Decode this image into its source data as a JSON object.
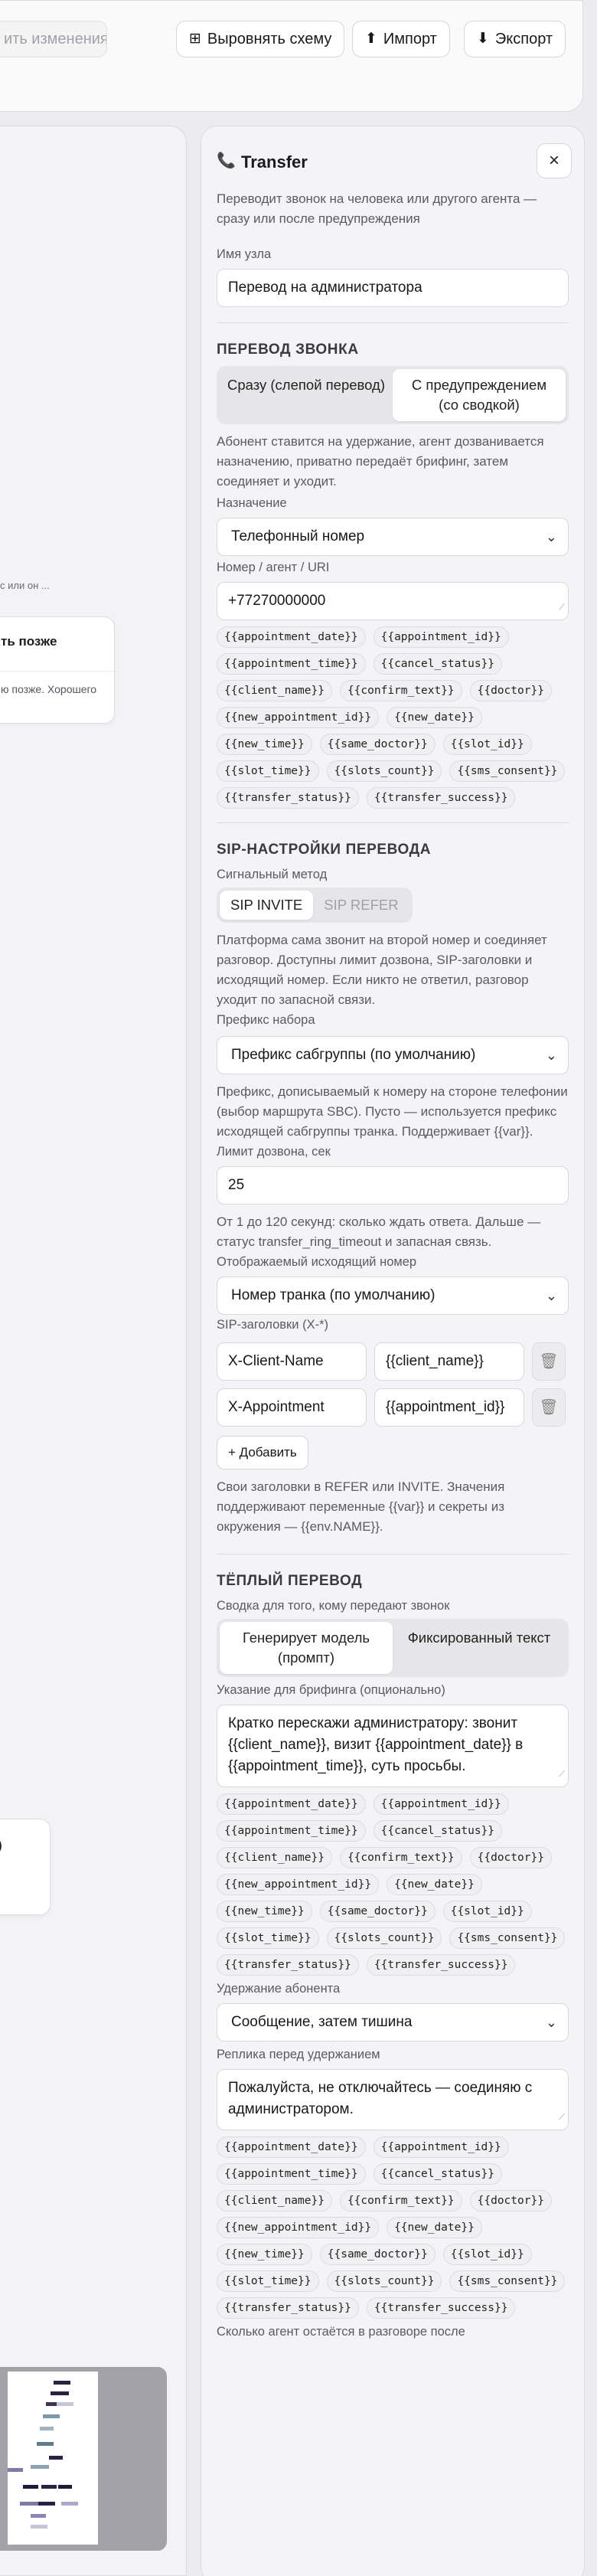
{
  "toolbar": {
    "save_label": "ить изменения",
    "align_label": "Выровнять схему",
    "import_label": "Импорт",
    "export_label": "Экспорт"
  },
  "canvas": {
    "hint_text": "с или он ...",
    "node1_title": "ть позже",
    "node1_sub": "ю позже. Хорошего",
    "node2_title": ")"
  },
  "panel": {
    "title": "Transfer",
    "description": "Переводит звонок на человека или другого агента — сразу или после предупреждения",
    "node_name_label": "Имя узла",
    "node_name_value": "Перевод на администратора",
    "call_transfer": {
      "heading": "ПЕРЕВОД ЗВОНКА",
      "mode_options": [
        "Сразу (слепой перевод)",
        "С предупреждением (со сводкой)"
      ],
      "mode_selected": 1,
      "mode_desc": "Абонент ставится на удержание, агент дозванивается назначению, приватно передаёт брифинг, затем соединяет и уходит.",
      "destination_label": "Назначение",
      "destination_value": "Телефонный номер",
      "number_label": "Номер / агент / URI",
      "number_value": "+77270000000"
    },
    "variables": [
      "{{appointment_date}}",
      "{{appointment_id}}",
      "{{appointment_time}}",
      "{{cancel_status}}",
      "{{client_name}}",
      "{{confirm_text}}",
      "{{doctor}}",
      "{{new_appointment_id}}",
      "{{new_date}}",
      "{{new_time}}",
      "{{same_doctor}}",
      "{{slot_id}}",
      "{{slot_time}}",
      "{{slots_count}}",
      "{{sms_consent}}",
      "{{transfer_status}}",
      "{{transfer_success}}"
    ],
    "sip": {
      "heading": "SIP-НАСТРОЙКИ ПЕРЕВОДА",
      "method_label": "Сигнальный метод",
      "method_options": [
        "SIP INVITE",
        "SIP REFER"
      ],
      "method_selected": 0,
      "method_desc": "Платформа сама звонит на второй номер и соединяет разговор. Доступны лимит дозвона, SIP-заголовки и исходящий номер. Если никто не ответил, разговор уходит по запасной связи.",
      "prefix_label": "Префикс набора",
      "prefix_value": "Префикс сабгруппы (по умолчанию)",
      "prefix_desc": "Префикс, дописываемый к номеру на стороне телефонии (выбор маршрута SBC). Пусто — используется префикс исходящей сабгруппы транка. Поддерживает {{var}}.",
      "ring_label": "Лимит дозвона, сек",
      "ring_value": "25",
      "ring_desc": "От 1 до 120 секунд: сколько ждать ответа. Дальше — статус transfer_ring_timeout и запасная связь.",
      "caller_label": "Отображаемый исходящий номер",
      "caller_value": "Номер транка (по умолчанию)",
      "headers_label": "SIP-заголовки (X-*)",
      "headers": [
        {
          "name": "X-Client-Name",
          "value": "{{client_name}}"
        },
        {
          "name": "X-Appointment",
          "value": "{{appointment_id}}"
        }
      ],
      "add_label": "+ Добавить",
      "headers_desc": "Свои заголовки в REFER или INVITE. Значения поддерживают переменные {{var}} и секреты из окружения — {{env.NAME}}."
    },
    "warm": {
      "heading": "ТЁПЛЫЙ ПЕРЕВОД",
      "summary_label": "Сводка для того, кому передают звонок",
      "summary_options": [
        "Генерирует модель (промпт)",
        "Фиксированный текст"
      ],
      "summary_selected": 0,
      "brief_label": "Указание для брифинга (опционально)",
      "brief_value": "Кратко перескажи администратору: звонит {{client_name}}, визит {{appointment_date}} в {{appointment_time}}, суть просьбы.",
      "hold_label": "Удержание абонента",
      "hold_value": "Сообщение, затем тишина",
      "hold_phrase_label": "Реплика перед удержанием",
      "hold_phrase_value": "Пожалуйста, не отключайтесь — соединяю с администратором.",
      "stay_label": "Сколько агент остаётся в разговоре после"
    }
  }
}
